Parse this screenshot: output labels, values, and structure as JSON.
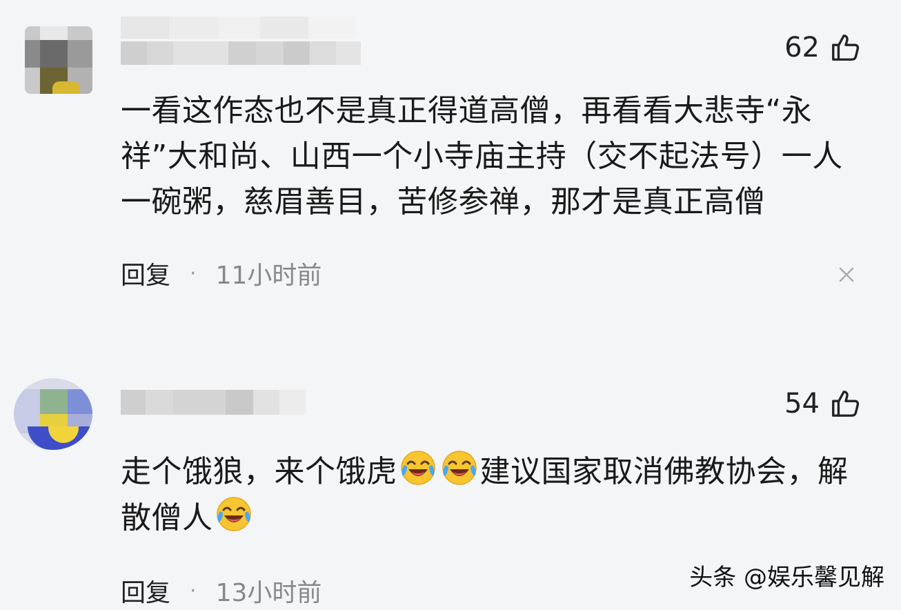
{
  "comments": [
    {
      "likes": "62",
      "text": "一看这作态也不是真正得道高僧，再看看大悲寺“永祥”大和尚、山西一个小寺庙主持（交不起法号）一人一碗粥，慈眉善目，苦修参禅，那才是真正高僧",
      "reply_label": "回复",
      "separator": "·",
      "time": "11小时前"
    },
    {
      "likes": "54",
      "text_part1": "走个饿狼，来个饿虎",
      "text_part2": "建议国家取消佛教协会，解散僧人",
      "reply_label": "回复",
      "separator": "·",
      "time": "13小时前"
    }
  ],
  "icons": {
    "like": "thumbs-up-icon",
    "dismiss": "close-icon",
    "emoji": "laughing-crying-emoji"
  },
  "watermark": "头条 @娱乐馨见解",
  "colors": {
    "background": "#f4f5f7",
    "text": "#1a1a1a",
    "muted": "#888888"
  }
}
